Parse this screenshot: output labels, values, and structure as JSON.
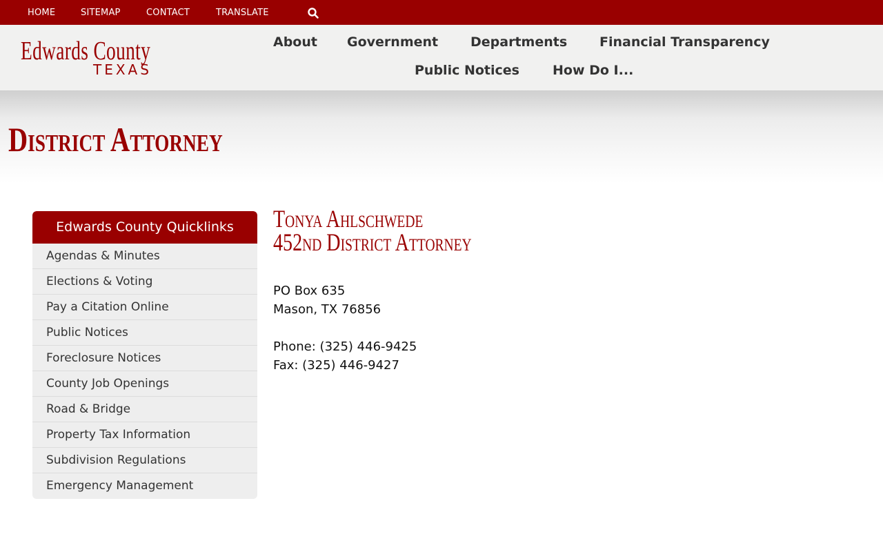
{
  "topbar": {
    "links": [
      "HOME",
      "SITEMAP",
      "CONTACT",
      "TRANSLATE"
    ]
  },
  "logo": {
    "main": "Edwards County",
    "sub": "TEXAS"
  },
  "nav": {
    "row1": [
      "About",
      "Government",
      "Departments",
      "Financial Transparency"
    ],
    "row2": [
      "Public Notices",
      "How Do I..."
    ]
  },
  "page": {
    "title": "District Attorney"
  },
  "sidebar": {
    "heading": "Edwards County Quicklinks",
    "items": [
      "Agendas & Minutes",
      "Elections & Voting",
      "Pay a Citation Online",
      "Public Notices",
      "Foreclosure Notices",
      "County Job Openings",
      "Road & Bridge",
      "Property Tax Information",
      "Subdivision Regulations",
      "Emergency Management"
    ]
  },
  "content": {
    "name": "Tonya Ahlschwede",
    "role_prefix": "452",
    "role_suffix": "nd",
    "role_rest": " District Attorney",
    "address_line1": "PO Box 635",
    "address_line2": "Mason, TX 76856",
    "phone": "Phone: (325) 446-9425",
    "fax": "Fax: (325) 446-9427"
  },
  "colors": {
    "brand": "#990000",
    "header_bg": "#f1f1f0",
    "sidebar_bg": "#eeeeee"
  }
}
